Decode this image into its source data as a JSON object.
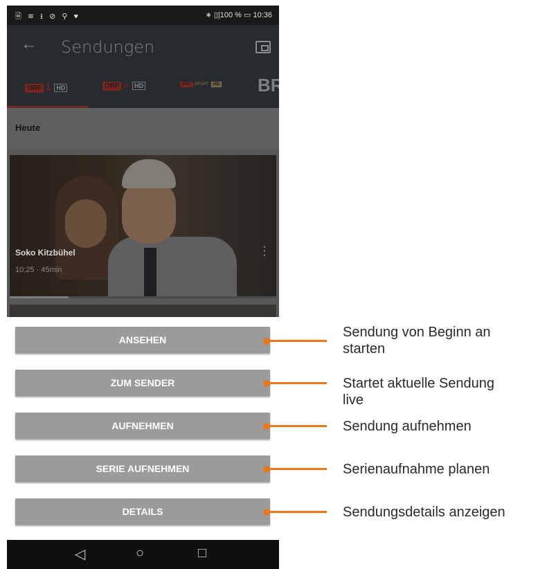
{
  "statusbar": {
    "left_icons": "🗎 ≋ ⭳ ⊘ ⚲ ♥",
    "right": "∗ ▯|100 % ▭ 10:36"
  },
  "appbar": {
    "title": "Sendungen",
    "back_icon": "arrow-back-icon",
    "cast_icon": "cast-icon"
  },
  "channels": [
    {
      "logo": "ORF",
      "mark": "1",
      "hd": "HD"
    },
    {
      "logo": "ORF",
      "mark": "∞",
      "hd": "HD"
    },
    {
      "logo": "ORF",
      "mark": "SPORT",
      "hd": "HD"
    },
    {
      "logo": "BR"
    }
  ],
  "date_header": "Heute",
  "program": {
    "title": "Soko Kitzbühel",
    "meta": "10:25 · 45min",
    "progress_fraction": 0.22
  },
  "actions": [
    {
      "label": "ANSEHEN",
      "annotation_line1": "Sendung von Beginn an",
      "annotation_line2": "starten"
    },
    {
      "label": "ZUM SENDER",
      "annotation_line1": "Startet aktuelle Sendung",
      "annotation_line2": "live"
    },
    {
      "label": "AUFNEHMEN",
      "annotation_line1": "Sendung aufnehmen",
      "annotation_line2": ""
    },
    {
      "label": "SERIE AUFNEHMEN",
      "annotation_line1": "Serienaufnahme planen",
      "annotation_line2": ""
    },
    {
      "label": "DETAILS",
      "annotation_line1": "Sendungsdetails anzeigen",
      "annotation_line2": ""
    }
  ],
  "navbar": {
    "back": "◁",
    "home": "○",
    "recents": "□"
  },
  "colors": {
    "accent": "#e87722",
    "button_gray": "#9b9b9b"
  }
}
